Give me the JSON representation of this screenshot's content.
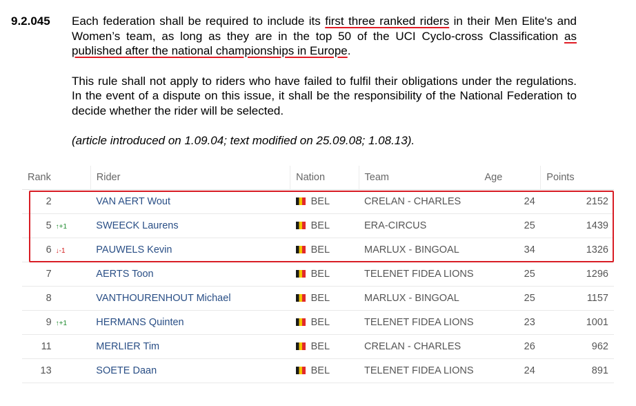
{
  "article": {
    "number": "9.2.045",
    "p1_a": "Each federation shall be required to include its ",
    "p1_u1": "first three ranked riders",
    "p1_b": " in their Men Elite's and Women’s team, as long as they are in the top 50 of the UCI Cyclo-cross Classification ",
    "p1_u2": "as published after the national championships in Europe",
    "p1_c": ".",
    "p2": "This rule shall not apply to riders who have failed to fulfil their obligations under the regulations. In the event of a dispute on this issue, it shall be the responsibility of the National Federation to decide whether the rider will be selected.",
    "note": "(article introduced on 1.09.04; text modified on 25.09.08; 1.08.13).",
    "underline_color": "#e01b24"
  },
  "table": {
    "headers": {
      "rank": "Rank",
      "rider": "Rider",
      "nation": "Nation",
      "team": "Team",
      "age": "Age",
      "points": "Points"
    },
    "rows": [
      {
        "rank": "2",
        "change": "",
        "dir": "",
        "rider": "VAN AERT Wout",
        "nation": "BEL",
        "team": "CRELAN - CHARLES",
        "age": "24",
        "points": "2152"
      },
      {
        "rank": "5",
        "change": "↑+1",
        "dir": "up",
        "rider": "SWEECK Laurens",
        "nation": "BEL",
        "team": "ERA-CIRCUS",
        "age": "25",
        "points": "1439"
      },
      {
        "rank": "6",
        "change": "↓-1",
        "dir": "down",
        "rider": "PAUWELS Kevin",
        "nation": "BEL",
        "team": "MARLUX - BINGOAL",
        "age": "34",
        "points": "1326"
      },
      {
        "rank": "7",
        "change": "",
        "dir": "",
        "rider": "AERTS Toon",
        "nation": "BEL",
        "team": "TELENET FIDEA LIONS",
        "age": "25",
        "points": "1296"
      },
      {
        "rank": "8",
        "change": "",
        "dir": "",
        "rider": "VANTHOURENHOUT Michael",
        "nation": "BEL",
        "team": "MARLUX - BINGOAL",
        "age": "25",
        "points": "1157"
      },
      {
        "rank": "9",
        "change": "↑+1",
        "dir": "up",
        "rider": "HERMANS Quinten",
        "nation": "BEL",
        "team": "TELENET FIDEA LIONS",
        "age": "23",
        "points": "1001"
      },
      {
        "rank": "11",
        "change": "",
        "dir": "",
        "rider": "MERLIER Tim",
        "nation": "BEL",
        "team": "CRELAN - CHARLES",
        "age": "26",
        "points": "962"
      },
      {
        "rank": "13",
        "change": "",
        "dir": "",
        "rider": "SOETE Daan",
        "nation": "BEL",
        "team": "TELENET FIDEA LIONS",
        "age": "24",
        "points": "891"
      }
    ],
    "highlight_color": "#d81c24",
    "flag_icon": "belgium-flag-icon"
  }
}
